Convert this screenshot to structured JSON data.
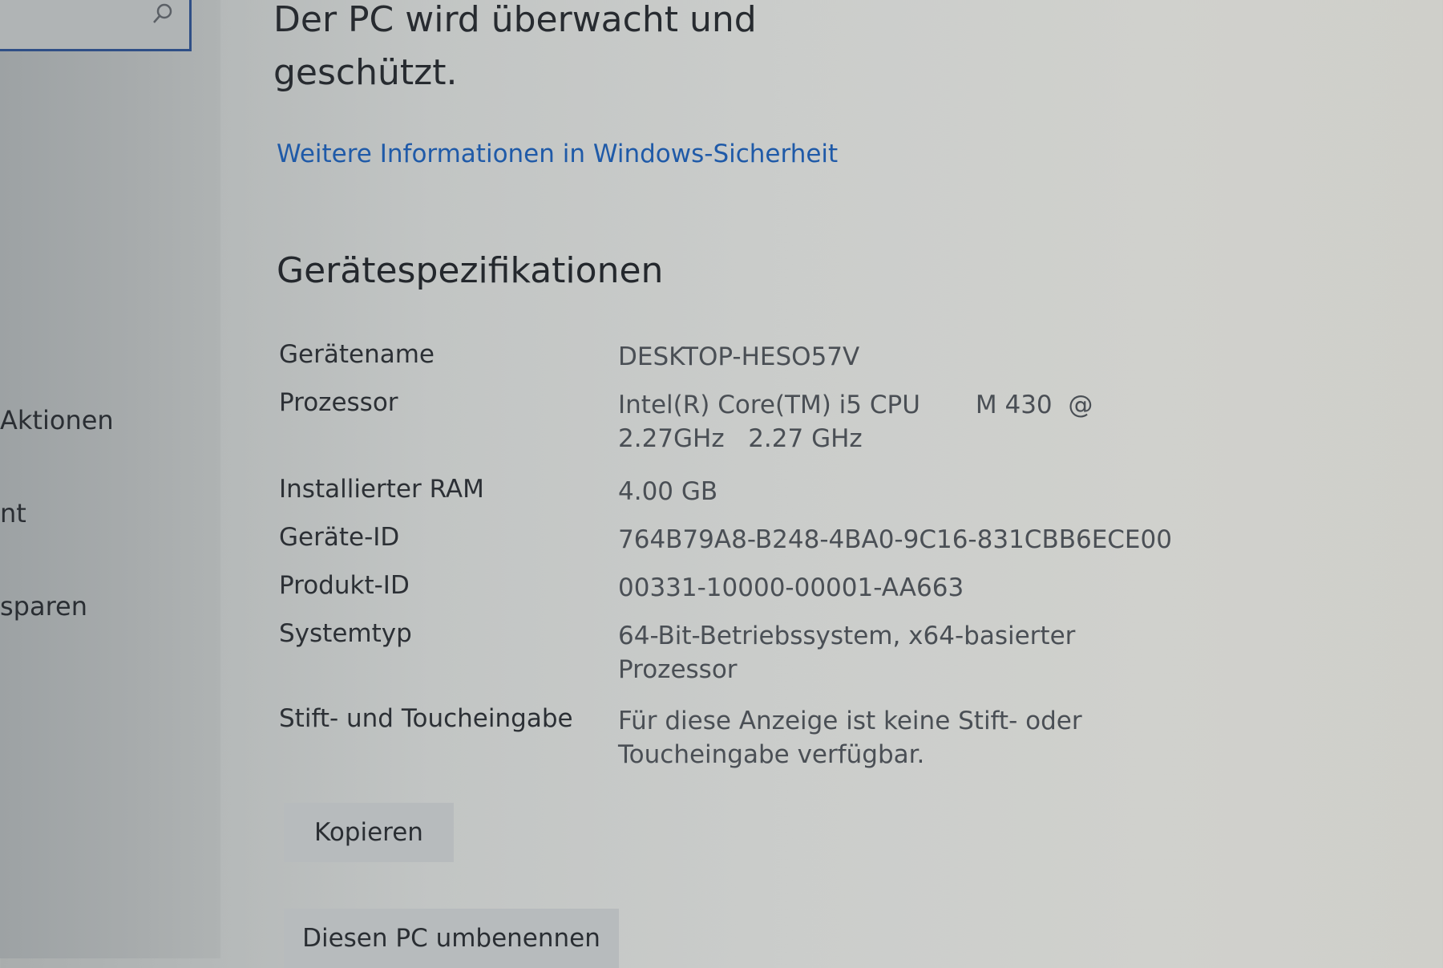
{
  "sidebar": {
    "search_icon": "search-icon",
    "items": [
      {
        "label": "Aktionen"
      },
      {
        "label": "nt"
      },
      {
        "label": "sparen"
      }
    ]
  },
  "main": {
    "headline": "Der PC wird überwacht und geschützt.",
    "link": "Weitere Informationen in Windows-Sicherheit",
    "section_title": "Gerätespezifikationen",
    "specs": [
      {
        "label": "Gerätename",
        "value": "DESKTOP-HESO57V"
      },
      {
        "label": "Prozessor",
        "value": "Intel(R) Core(TM) i5 CPU       M 430  @ 2.27GHz   2.27 GHz"
      },
      {
        "label": "Installierter RAM",
        "value": "4.00 GB"
      },
      {
        "label": "Geräte-ID",
        "value": "764B79A8-B248-4BA0-9C16-831CBB6ECE00"
      },
      {
        "label": "Produkt-ID",
        "value": "00331-10000-00001-AA663"
      },
      {
        "label": "Systemtyp",
        "value": "64-Bit-Betriebssystem, x64-basierter Prozessor"
      },
      {
        "label": "Stift- und Toucheingabe",
        "value": "Für diese Anzeige ist keine Stift- oder Toucheingabe verfügbar."
      }
    ],
    "copy_button": "Kopieren",
    "rename_button": "Diesen PC umbenennen"
  }
}
